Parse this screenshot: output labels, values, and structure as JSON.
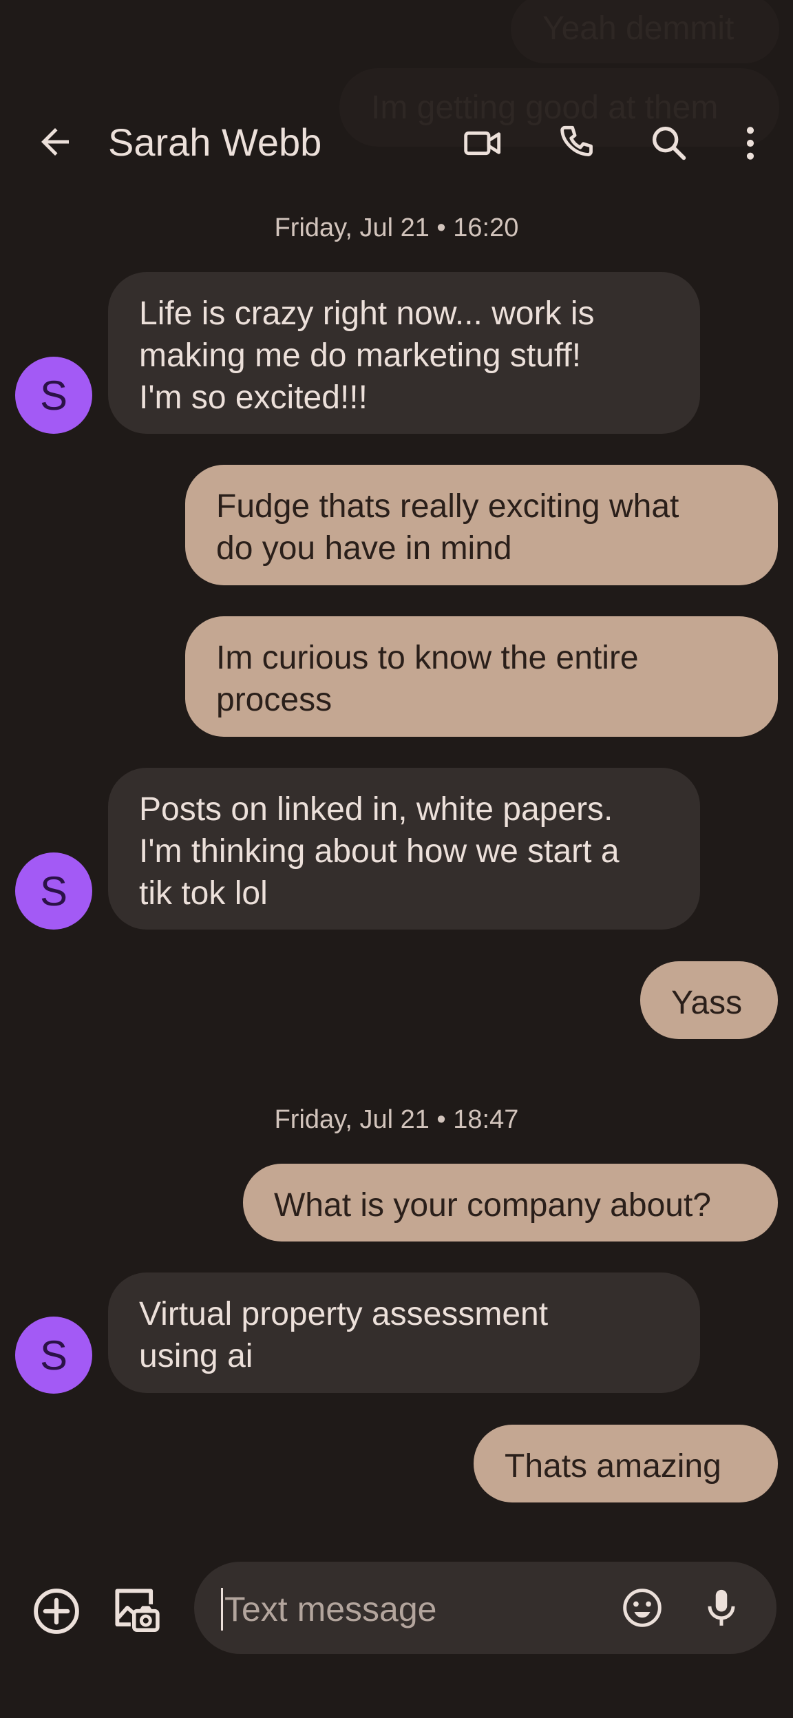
{
  "ghost_messages": [
    "Yeah demmit",
    "Im getting good at them"
  ],
  "header": {
    "title": "Sarah Webb",
    "icons": [
      "back-arrow-icon",
      "video-call-icon",
      "phone-icon",
      "search-icon",
      "more-vert-icon"
    ]
  },
  "thread": [
    {
      "type": "date",
      "text": "Friday, Jul 21 • 16:20"
    },
    {
      "type": "incoming",
      "avatar": "S",
      "lines": [
        "Life is crazy right now... work is",
        "making me do marketing stuff!",
        "I'm so excited!!!"
      ]
    },
    {
      "type": "outgoing",
      "lines": [
        "Fudge thats really exciting what",
        "do you have in mind"
      ]
    },
    {
      "type": "outgoing",
      "lines": [
        "Im curious to know the entire",
        "process"
      ]
    },
    {
      "type": "incoming",
      "avatar": "S",
      "lines": [
        "Posts on linked in, white papers.",
        "I'm thinking about how we start a",
        "tik tok lol"
      ]
    },
    {
      "type": "outgoing",
      "lines": [
        "Yass"
      ]
    },
    {
      "type": "date",
      "text": "Friday, Jul 21 • 18:47"
    },
    {
      "type": "outgoing",
      "lines": [
        "What is your company about?"
      ]
    },
    {
      "type": "incoming",
      "avatar": "S",
      "lines": [
        "Virtual property assessment",
        "using ai"
      ]
    },
    {
      "type": "outgoing",
      "lines": [
        "Thats amazing"
      ]
    }
  ],
  "composer": {
    "placeholder": "Text message",
    "icons": [
      "add-circle-icon",
      "gallery-camera-icon",
      "emoji-icon",
      "microphone-icon"
    ]
  },
  "colors": {
    "background": "#1f1a18",
    "incoming_bubble": "#342e2c",
    "outgoing_bubble": "#c4a792",
    "avatar": "#a35af5"
  }
}
